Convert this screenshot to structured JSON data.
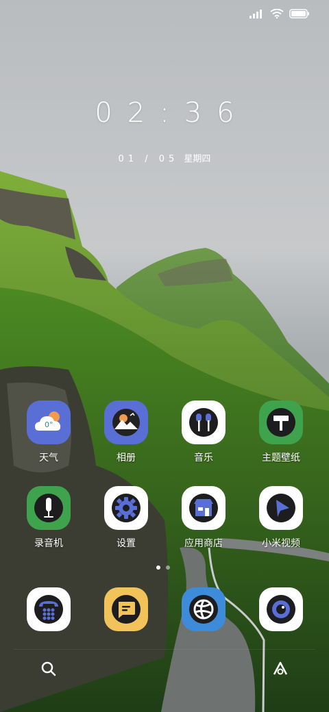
{
  "status_bar": {
    "signal_icon": "signal-icon",
    "wifi_icon": "wifi-icon",
    "battery_icon": "battery-icon"
  },
  "lock": {
    "time": "02:36",
    "date": "01 / 05",
    "weekday": "星期四"
  },
  "apps": [
    {
      "label": "天气",
      "icon": "weather-icon",
      "weather_text": "0°"
    },
    {
      "label": "相册",
      "icon": "gallery-icon"
    },
    {
      "label": "音乐",
      "icon": "music-icon"
    },
    {
      "label": "主题壁纸",
      "icon": "themes-icon"
    },
    {
      "label": "录音机",
      "icon": "recorder-icon"
    },
    {
      "label": "设置",
      "icon": "settings-icon"
    },
    {
      "label": "应用商店",
      "icon": "app-store-icon"
    },
    {
      "label": "小米视频",
      "icon": "video-icon"
    }
  ],
  "dock": [
    {
      "icon": "phone-icon"
    },
    {
      "icon": "messages-icon"
    },
    {
      "icon": "browser-icon"
    },
    {
      "icon": "camera-icon"
    }
  ],
  "pager": {
    "pages": 2,
    "current": 1
  },
  "bottom_bar": {
    "search_icon": "search-icon",
    "assistant_icon": "assistant-icon"
  },
  "colors": {
    "accent_blue": "#5a6fd6",
    "accent_green": "#3fa34d",
    "accent_yellow": "#f2c35a",
    "accent_sky": "#3d8bd9"
  }
}
